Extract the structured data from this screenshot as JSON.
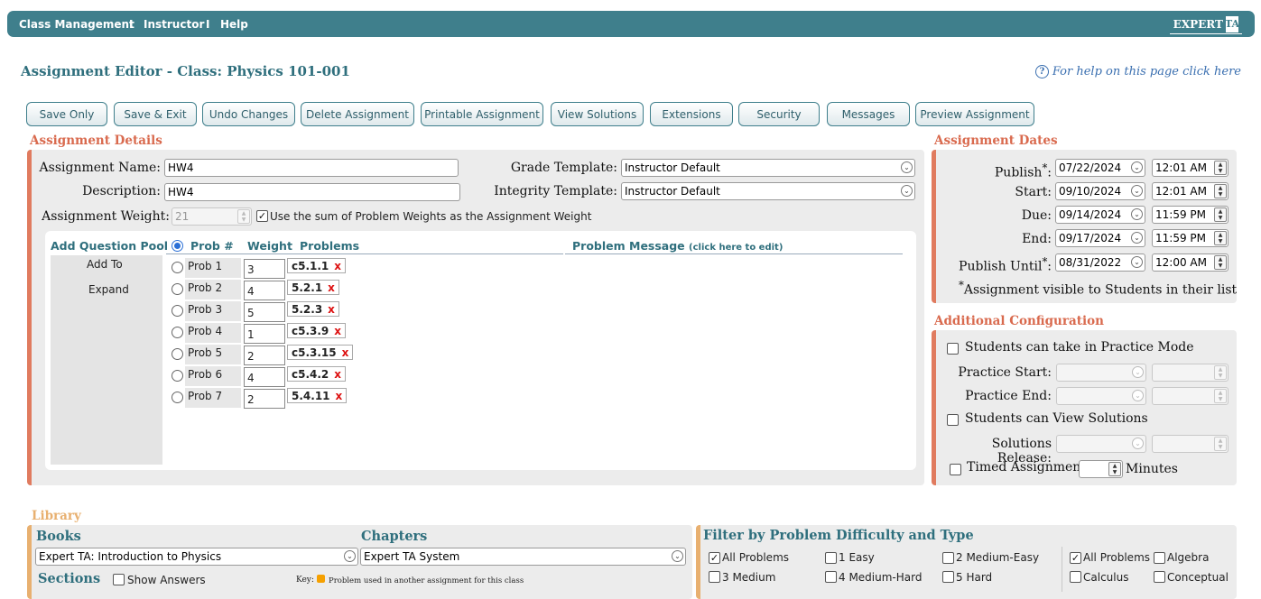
{
  "nav": {
    "items": [
      "Class Management",
      "Instructor",
      "Help"
    ],
    "sep": "I",
    "logo_text": "EXPERT",
    "logo_mark": "TA"
  },
  "page_title": "Assignment Editor - Class: Physics 101-001",
  "help_link": "For help on this page click here",
  "toolbar": [
    "Save Only",
    "Save & Exit",
    "Undo Changes",
    "Delete Assignment",
    "Printable Assignment",
    "View Solutions",
    "Extensions",
    "Security",
    "Messages",
    "Preview Assignment"
  ],
  "details": {
    "title": "Assignment Details",
    "name_label": "Assignment Name:",
    "name_value": "HW4",
    "desc_label": "Description:",
    "desc_value": "HW4",
    "weight_label": "Assignment Weight:",
    "weight_value": "21",
    "sum_weights_label": "Use the sum of Problem Weights as the Assignment Weight",
    "sum_weights_checked": true,
    "grade_template_label": "Grade Template:",
    "grade_template_value": "Instructor Default",
    "integrity_template_label": "Integrity Template:",
    "integrity_template_value": "Instructor Default"
  },
  "problems": {
    "pool_header": "Add Question Pool",
    "pool_actions": [
      "Add To",
      "Expand"
    ],
    "col_prob": "Prob #",
    "col_weight": "Weight",
    "col_problems": "Problems",
    "col_message": "Problem Message",
    "col_message_hint": "(click here to edit)",
    "remove_glyph": "x",
    "rows": [
      {
        "label": "Prob 1",
        "weight": "3",
        "problem": "c5.1.1"
      },
      {
        "label": "Prob 2",
        "weight": "4",
        "problem": "5.2.1"
      },
      {
        "label": "Prob 3",
        "weight": "5",
        "problem": "5.2.3"
      },
      {
        "label": "Prob 4",
        "weight": "1",
        "problem": "c5.3.9"
      },
      {
        "label": "Prob 5",
        "weight": "2",
        "problem": "c5.3.15"
      },
      {
        "label": "Prob 6",
        "weight": "4",
        "problem": "c5.4.2"
      },
      {
        "label": "Prob 7",
        "weight": "2",
        "problem": "5.4.11"
      }
    ]
  },
  "dates": {
    "title": "Assignment Dates",
    "star": "*",
    "rows": [
      {
        "label": "Publish",
        "starred": true,
        "date": "07/22/2024",
        "time": "12:01 AM"
      },
      {
        "label": "Start:",
        "starred": false,
        "date": "09/10/2024",
        "time": "12:01 AM"
      },
      {
        "label": "Due:",
        "starred": false,
        "date": "09/14/2024",
        "time": "11:59 PM"
      },
      {
        "label": "End:",
        "starred": false,
        "date": "09/17/2024",
        "time": "11:59 PM"
      },
      {
        "label": "Publish Until",
        "starred": true,
        "date": "08/31/2022",
        "time": "12:00 AM"
      }
    ],
    "footnote": "Assignment visible to Students in their list"
  },
  "config": {
    "title": "Additional Configuration",
    "practice_mode": "Students can take in Practice Mode",
    "practice_start": "Practice Start:",
    "practice_end": "Practice End:",
    "view_solutions": "Students can View Solutions",
    "solutions_release": "Solutions Release:",
    "timed": "Timed Assignment",
    "minutes": "Minutes"
  },
  "library": {
    "title": "Library",
    "books_label": "Books",
    "book_value": "Expert TA:  Introduction to Physics",
    "chapters_label": "Chapters",
    "chapter_value": "Expert TA System",
    "sections_label": "Sections",
    "show_answers": "Show Answers",
    "key_label": "Key:",
    "key_text": "Problem used in another assignment for this class",
    "key_color": "#f5a000"
  },
  "filter": {
    "title": "Filter by Problem Difficulty and Type",
    "difficulty": [
      {
        "label": "All Problems",
        "checked": true
      },
      {
        "label": "1 Easy",
        "checked": false
      },
      {
        "label": "2 Medium-Easy",
        "checked": false
      },
      {
        "label": "3 Medium",
        "checked": false
      },
      {
        "label": "4 Medium-Hard",
        "checked": false
      },
      {
        "label": "5 Hard",
        "checked": false
      }
    ],
    "types": [
      {
        "label": "All Problems",
        "checked": true
      },
      {
        "label": "Algebra",
        "checked": false
      },
      {
        "label": "Calculus",
        "checked": false
      },
      {
        "label": "Conceptual",
        "checked": false
      }
    ]
  },
  "colors": {
    "accent": "#3f7f8c",
    "section_title": "#d96a4e",
    "library_title": "#e8b070"
  }
}
